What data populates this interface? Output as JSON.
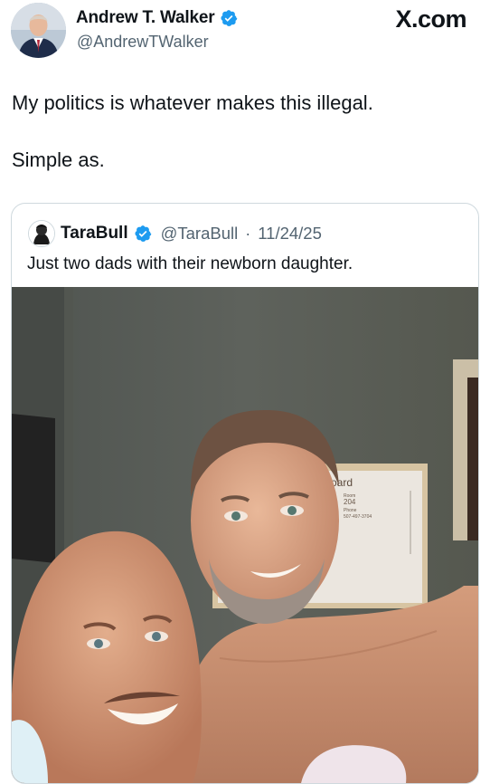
{
  "post": {
    "author_name": "Andrew T. Walker",
    "author_handle": "@AndrewTWalker",
    "site": "X.com",
    "text_line1": "My politics is whatever makes this illegal.",
    "text_line2": "Simple as."
  },
  "quoted": {
    "author_name": "TaraBull",
    "author_handle": "@TaraBull",
    "separator": "·",
    "date": "11/24/25",
    "text": "Just two dads with their newborn daughter.",
    "photo_board": {
      "title": "Board",
      "room_label": "Room",
      "room_number": "204",
      "phone_label": "Phone",
      "phone_number": "507-497-3704"
    }
  },
  "colors": {
    "verified_blue": "#1d9bf0",
    "text_primary": "#0f1419",
    "text_secondary": "#536471",
    "border": "#cfd9de"
  },
  "icons": [
    "verified-badge-icon",
    "avatar",
    "x-logo"
  ]
}
